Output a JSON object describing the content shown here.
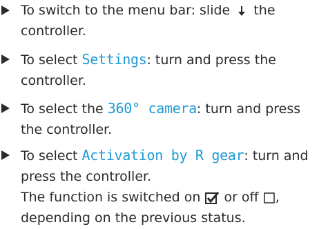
{
  "steps": [
    {
      "text_before": "To switch to the menu bar: slide",
      "icon": "slide-down-arrow-icon",
      "text_after": "the controller."
    },
    {
      "text_before": "To select ",
      "term": "Settings",
      "text_after": ": turn and press the controller."
    },
    {
      "text_before": "To select the ",
      "term": "360° camera",
      "text_after": ": turn and press the controller."
    },
    {
      "text_before": "To select ",
      "term": "Activation by R gear",
      "text_after": ": turn and press the controller.",
      "note_before": "The function is switched on",
      "note_on_icon": "checkbox-checked-icon",
      "note_mid": "or off",
      "note_off_icon": "checkbox-unchecked-icon",
      "note_after": ", depending on the previous status."
    }
  ],
  "colors": {
    "text": "#2a2a2a",
    "keyword": "#1e9ad6"
  }
}
